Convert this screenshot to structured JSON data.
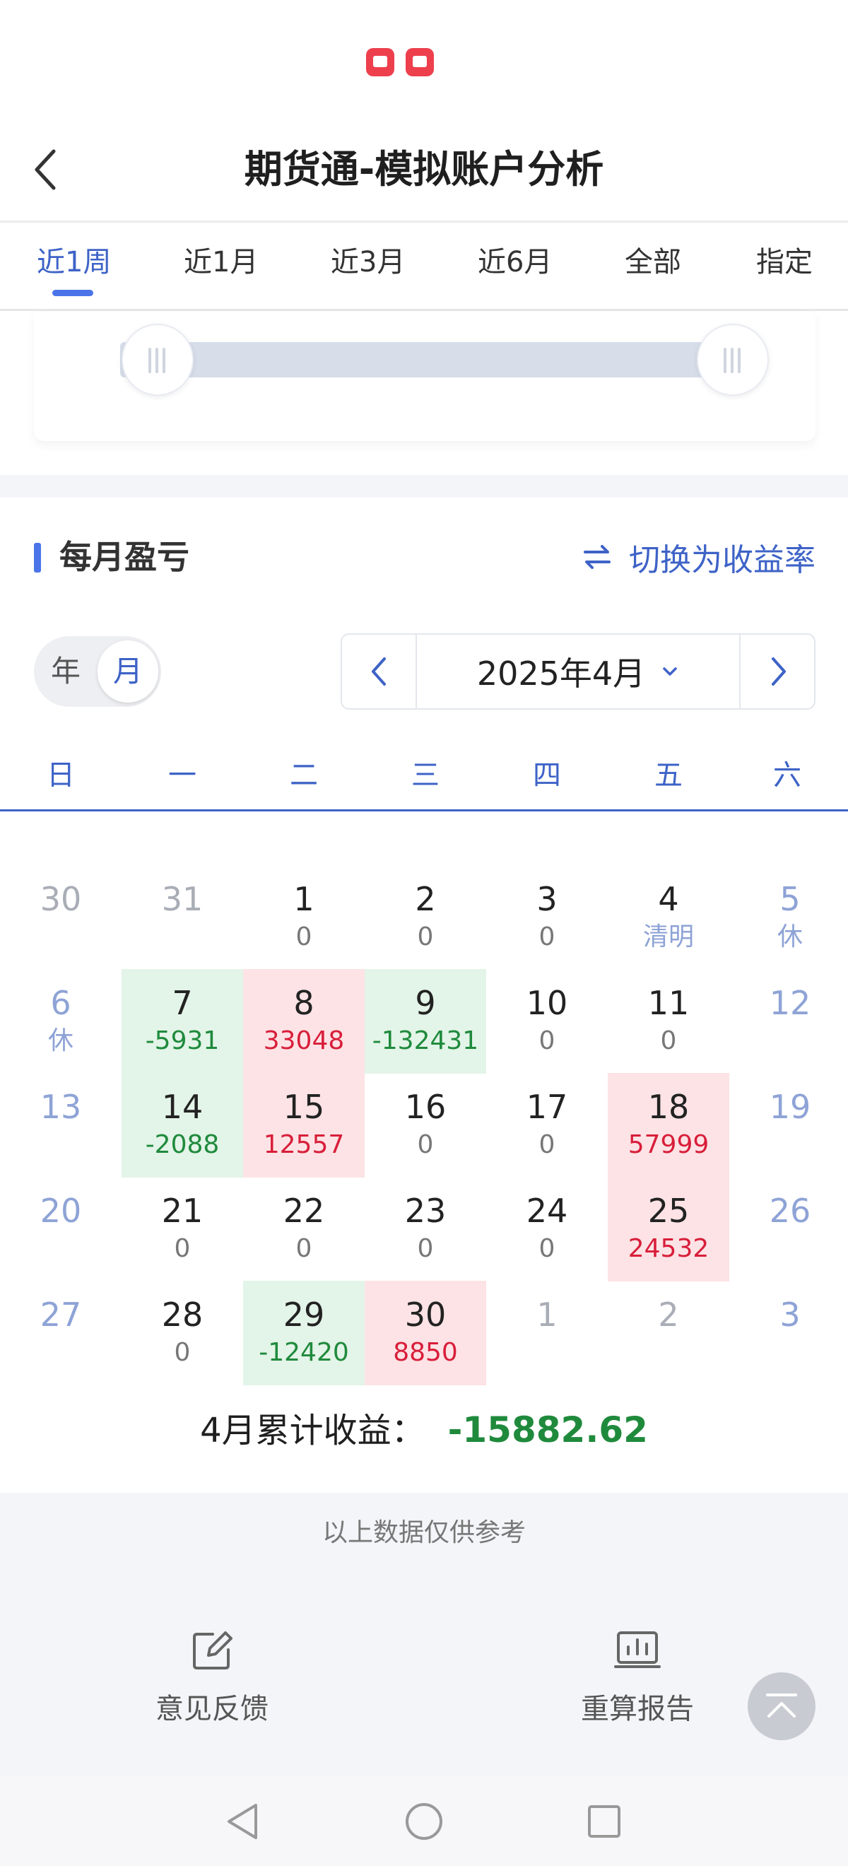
{
  "app": {
    "title": "期货通-模拟账户分析"
  },
  "tabs": [
    {
      "label": "近1周",
      "active": true
    },
    {
      "label": "近1月",
      "active": false
    },
    {
      "label": "近3月",
      "active": false
    },
    {
      "label": "近6月",
      "active": false
    },
    {
      "label": "全部",
      "active": false
    },
    {
      "label": "指定",
      "active": false
    }
  ],
  "monthly": {
    "title": "每月盈亏",
    "switch_label": "切换为收益率",
    "toggle": {
      "year": "年",
      "month": "月",
      "selected": "月"
    },
    "period": "2025年4月",
    "weekdays": [
      "日",
      "一",
      "二",
      "三",
      "四",
      "五",
      "六"
    ],
    "weeks": [
      [
        {
          "day": "30",
          "value": "",
          "kind": "other"
        },
        {
          "day": "31",
          "value": "",
          "kind": "other"
        },
        {
          "day": "1",
          "value": "0",
          "kind": "normal"
        },
        {
          "day": "2",
          "value": "0",
          "kind": "normal"
        },
        {
          "day": "3",
          "value": "0",
          "kind": "normal"
        },
        {
          "day": "4",
          "value": "清明",
          "kind": "holiday"
        },
        {
          "day": "5",
          "value": "休",
          "kind": "weekend"
        }
      ],
      [
        {
          "day": "6",
          "value": "休",
          "kind": "weekend"
        },
        {
          "day": "7",
          "value": "-5931",
          "kind": "loss"
        },
        {
          "day": "8",
          "value": "33048",
          "kind": "gain"
        },
        {
          "day": "9",
          "value": "-132431",
          "kind": "loss"
        },
        {
          "day": "10",
          "value": "0",
          "kind": "normal"
        },
        {
          "day": "11",
          "value": "0",
          "kind": "normal"
        },
        {
          "day": "12",
          "value": "",
          "kind": "weekend"
        }
      ],
      [
        {
          "day": "13",
          "value": "",
          "kind": "weekend"
        },
        {
          "day": "14",
          "value": "-2088",
          "kind": "loss"
        },
        {
          "day": "15",
          "value": "12557",
          "kind": "gain"
        },
        {
          "day": "16",
          "value": "0",
          "kind": "normal"
        },
        {
          "day": "17",
          "value": "0",
          "kind": "normal"
        },
        {
          "day": "18",
          "value": "57999",
          "kind": "gain"
        },
        {
          "day": "19",
          "value": "",
          "kind": "weekend"
        }
      ],
      [
        {
          "day": "20",
          "value": "",
          "kind": "weekend"
        },
        {
          "day": "21",
          "value": "0",
          "kind": "normal"
        },
        {
          "day": "22",
          "value": "0",
          "kind": "normal"
        },
        {
          "day": "23",
          "value": "0",
          "kind": "normal"
        },
        {
          "day": "24",
          "value": "0",
          "kind": "normal"
        },
        {
          "day": "25",
          "value": "24532",
          "kind": "gain"
        },
        {
          "day": "26",
          "value": "",
          "kind": "weekend"
        }
      ],
      [
        {
          "day": "27",
          "value": "",
          "kind": "weekend"
        },
        {
          "day": "28",
          "value": "0",
          "kind": "normal"
        },
        {
          "day": "29",
          "value": "-12420",
          "kind": "loss"
        },
        {
          "day": "30",
          "value": "8850",
          "kind": "gain"
        },
        {
          "day": "1",
          "value": "",
          "kind": "other"
        },
        {
          "day": "2",
          "value": "",
          "kind": "other"
        },
        {
          "day": "3",
          "value": "",
          "kind": "other-weekend"
        }
      ]
    ],
    "total_label": "4月累计收益：",
    "total_value": "-15882.62"
  },
  "footer": {
    "disclaimer": "以上数据仅供参考",
    "feedback_label": "意见反馈",
    "recalc_label": "重算报告"
  },
  "colors": {
    "accent": "#3e63c7",
    "gain": "#d81e3a",
    "gain_bg": "#fde3e5",
    "loss": "#1f8a3c",
    "loss_bg": "#e3f4e8"
  },
  "icons": [
    "back-arrow-icon",
    "swap-icon",
    "chevron-left-icon",
    "chevron-down-icon",
    "chevron-right-icon",
    "edit-icon",
    "report-chart-icon",
    "scroll-top-icon",
    "nav-back-icon",
    "nav-home-icon",
    "nav-recent-icon"
  ]
}
